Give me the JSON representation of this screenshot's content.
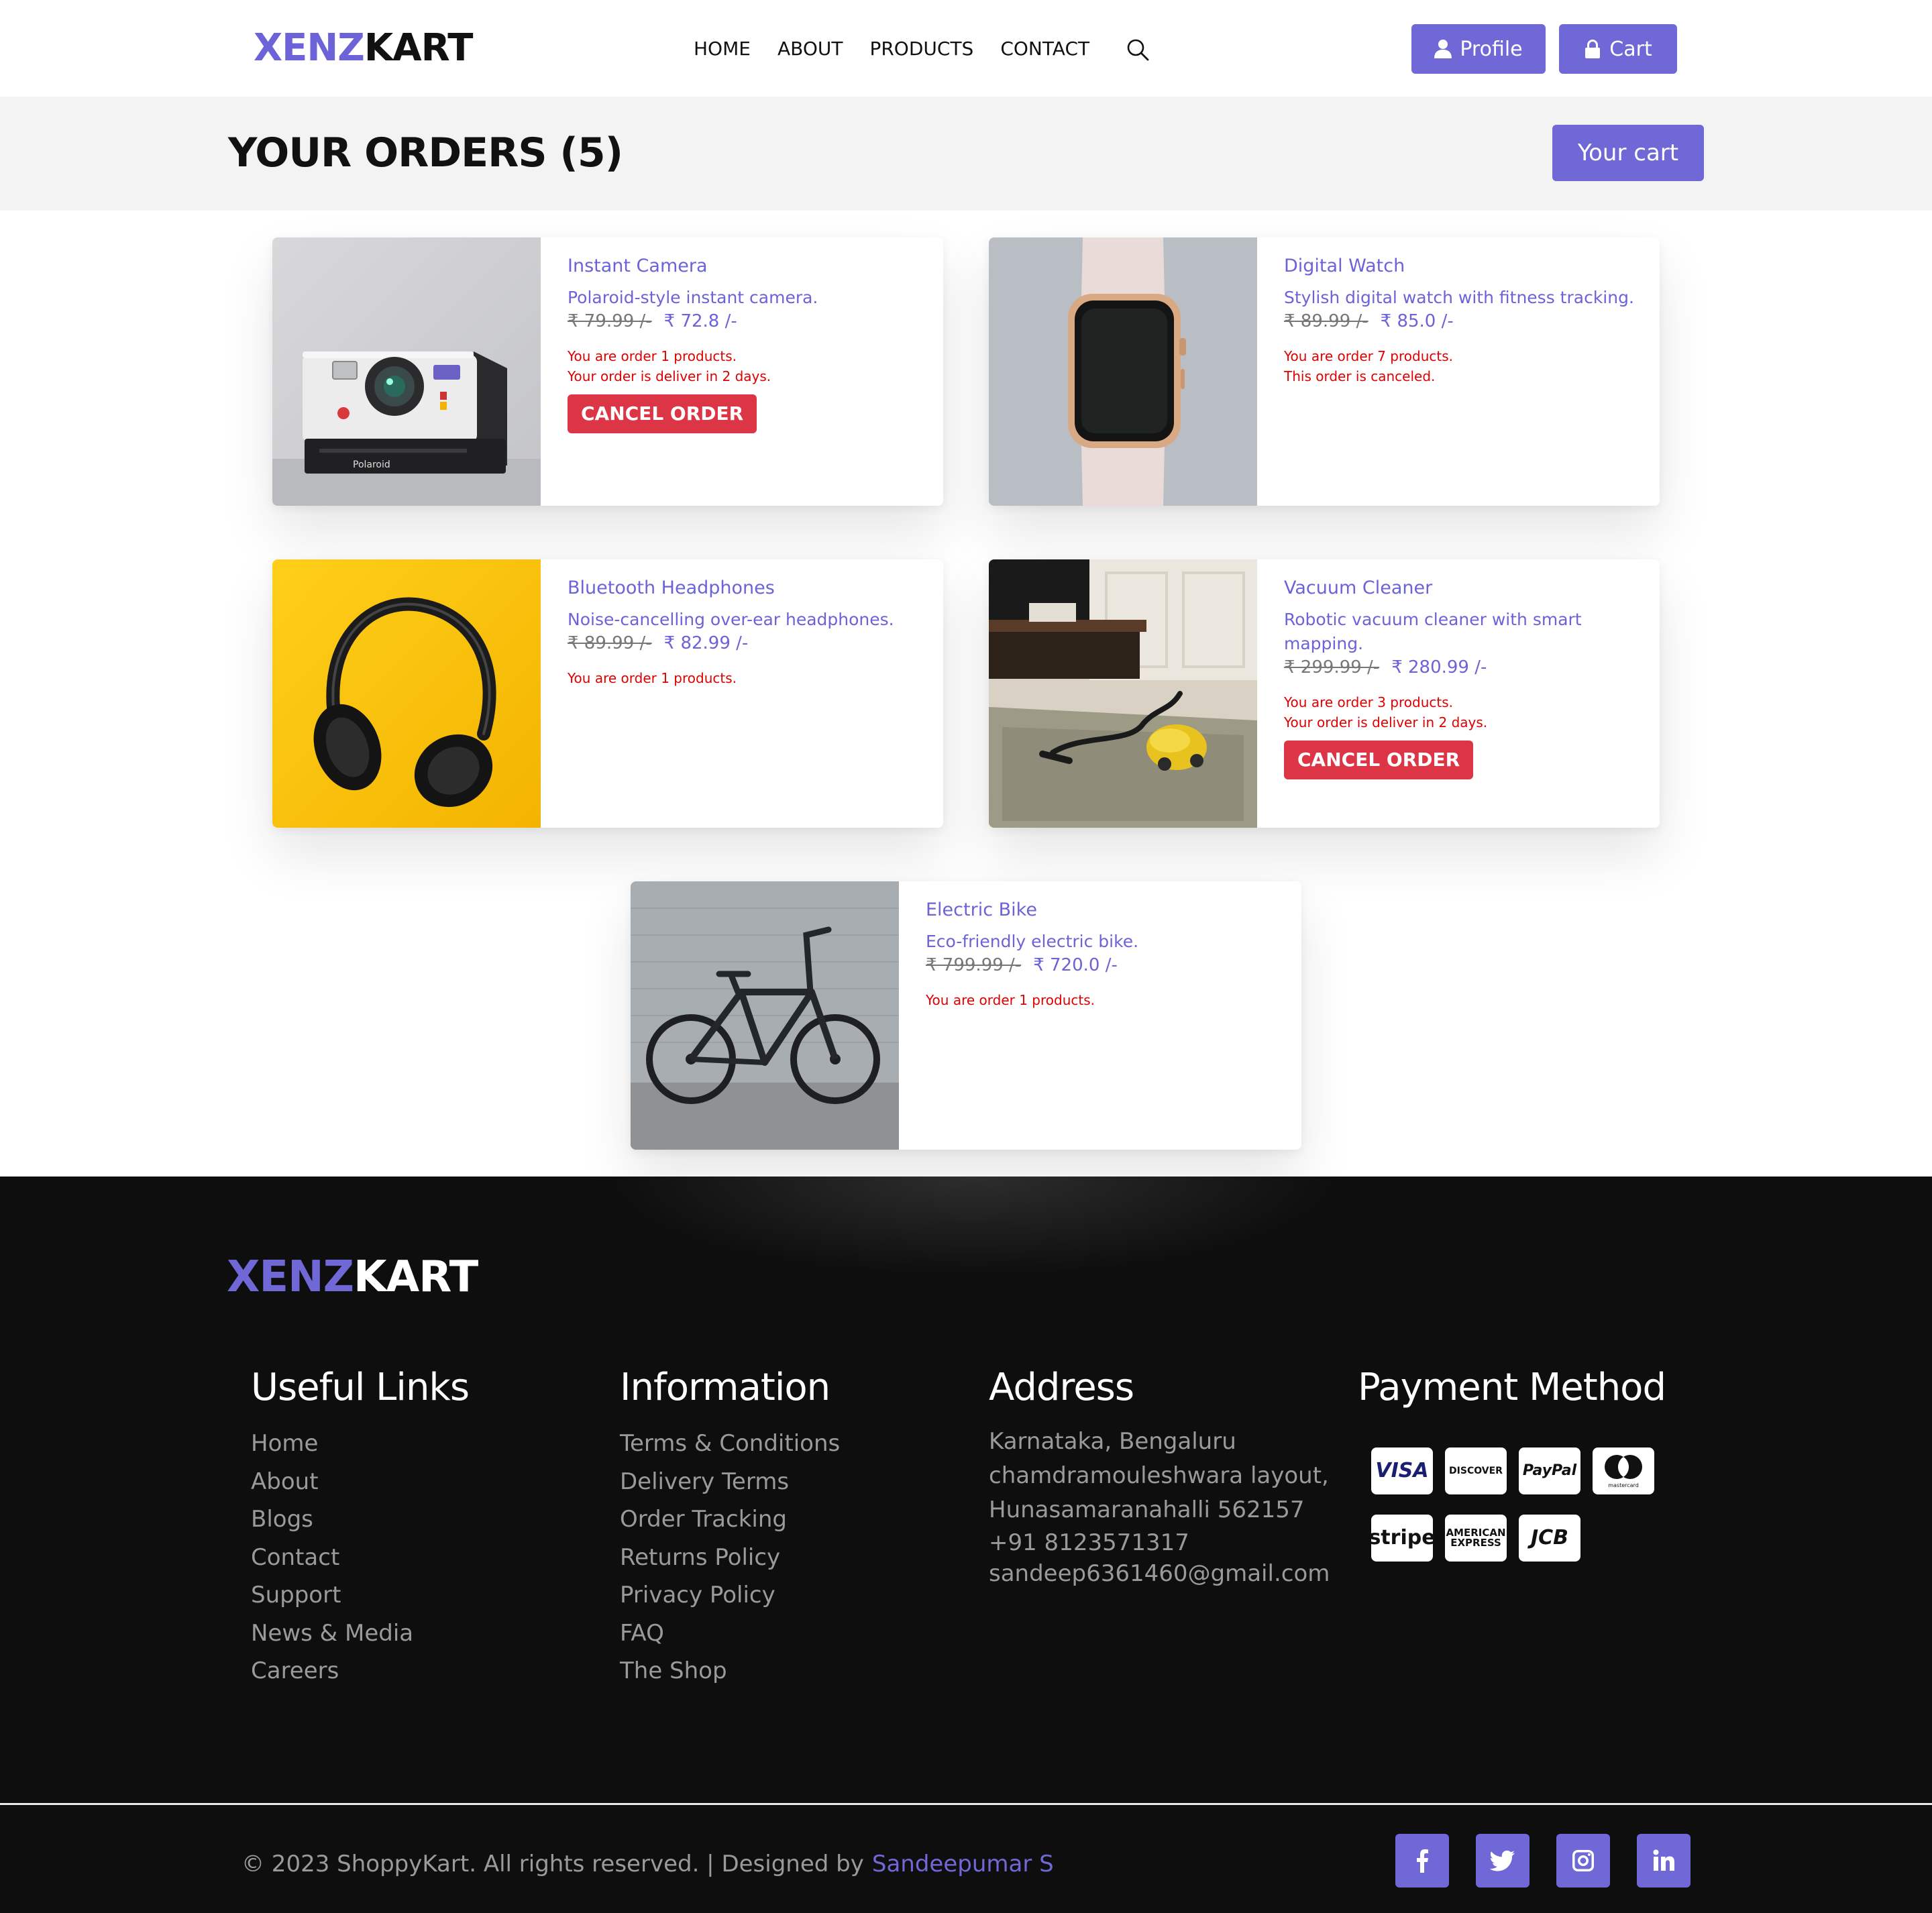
{
  "brand": {
    "part1": "XENZ",
    "part2": "KART"
  },
  "nav": {
    "links": [
      "HOME",
      "ABOUT",
      "PRODUCTS",
      "CONTACT"
    ],
    "search_icon": "search-icon",
    "profile_label": "Profile",
    "cart_label": "Cart"
  },
  "orders_header": {
    "title": "YOUR ORDERS (5)",
    "your_cart_label": "Your cart"
  },
  "orders": [
    {
      "name": "Instant Camera",
      "desc": "Polaroid-style instant camera.",
      "old_price": "₹ 79.99 /-",
      "new_price": "₹ 72.8 /-",
      "status1": "You are order 1 products.",
      "status2": "Your order is deliver in 2 days.",
      "cancel_label": "CANCEL ORDER"
    },
    {
      "name": "Digital Watch",
      "desc": "Stylish digital watch with fitness tracking.",
      "old_price": "₹ 89.99 /-",
      "new_price": "₹ 85.0 /-",
      "status1": "You are order 7 products.",
      "status2": "This order is canceled."
    },
    {
      "name": "Bluetooth Headphones",
      "desc": "Noise-cancelling over-ear headphones.",
      "old_price": "₹ 89.99 /-",
      "new_price": "₹ 82.99 /-",
      "status1": "You are order 1 products."
    },
    {
      "name": "Vacuum Cleaner",
      "desc": "Robotic vacuum cleaner with smart mapping.",
      "old_price": "₹ 299.99 /-",
      "new_price": "₹ 280.99 /-",
      "status1": "You are order 3 products.",
      "status2": "Your order is deliver in 2 days.",
      "cancel_label": "CANCEL ORDER"
    },
    {
      "name": "Electric Bike",
      "desc": "Eco-friendly electric bike.",
      "old_price": "₹ 799.99 /-",
      "new_price": "₹ 720.0 /-",
      "status1": "You are order 1 products."
    }
  ],
  "footer": {
    "brand": {
      "part1": "XENZ",
      "part2": "KART"
    },
    "useful_links": {
      "title": "Useful Links",
      "items": [
        "Home",
        "About",
        "Blogs",
        "Contact",
        "Support",
        "News & Media",
        "Careers"
      ]
    },
    "information": {
      "title": "Information",
      "items": [
        "Terms & Conditions",
        "Delivery Terms",
        "Order Tracking",
        "Returns Policy",
        "Privacy Policy",
        "FAQ",
        "The Shop"
      ]
    },
    "address": {
      "title": "Address",
      "line1": "Karnataka, Bengaluru chamdramouleshwara layout, Hunasamaranahalli 562157",
      "phone": "+91 8123571317",
      "email": "sandeep6361460@gmail.com"
    },
    "payment": {
      "title": "Payment Method",
      "visa": "VISA",
      "discover": "DISCOVER",
      "paypal": "PayPal",
      "mastercard": "mastercard",
      "stripe": "stripe",
      "amex": "AMERICAN EXPRESS",
      "jcb": "JCB"
    },
    "copyright": "© 2023 ShoppyKart. All rights reserved. | Designed by",
    "author": "Sandeepumar S",
    "social_icons": [
      "facebook-icon",
      "twitter-icon",
      "instagram-icon",
      "linkedin-icon"
    ]
  },
  "colors": {
    "accent": "#7068d6",
    "danger": "#dc3545",
    "footer_bg": "#0e0e0f",
    "status_red": "#e00000"
  }
}
